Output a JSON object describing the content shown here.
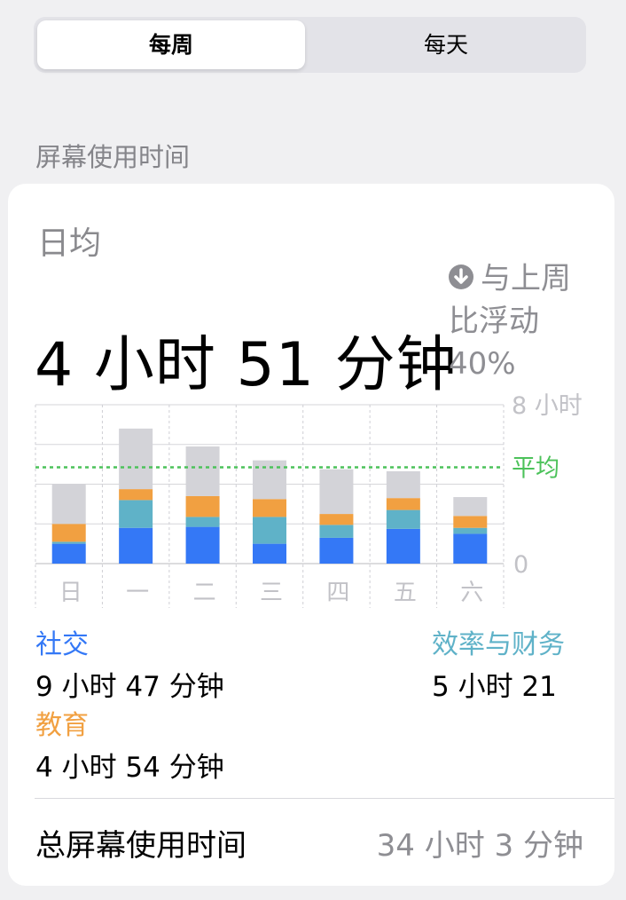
{
  "segment": {
    "weekly": "每周",
    "daily": "每天",
    "selected": "weekly"
  },
  "section_title": "屏幕使用时间",
  "summary": {
    "daily_avg_label": "日均",
    "daily_avg_value": "4 小时 51 分钟",
    "change_text": "与上周比浮动",
    "change_pct": "40%",
    "change_direction": "down"
  },
  "chart_data": {
    "type": "bar",
    "stacked": true,
    "unit": "小时",
    "categories": [
      "日",
      "一",
      "二",
      "三",
      "四",
      "五",
      "六"
    ],
    "series": [
      {
        "name": "社交",
        "color": "#3478f6",
        "values": [
          1.0,
          1.8,
          1.85,
          1.0,
          1.3,
          1.75,
          1.5
        ]
      },
      {
        "name": "效率与财务",
        "color": "#5fb2c8",
        "values": [
          0.1,
          1.4,
          0.5,
          1.35,
          0.65,
          0.95,
          0.3
        ]
      },
      {
        "name": "教育",
        "color": "#f1a041",
        "values": [
          0.9,
          0.55,
          1.05,
          0.9,
          0.55,
          0.6,
          0.6
        ]
      },
      {
        "name": "",
        "color": "#d3d3d8",
        "values": [
          2.0,
          3.05,
          2.5,
          1.95,
          2.25,
          1.35,
          0.95
        ]
      }
    ],
    "ylim": [
      0,
      8
    ],
    "y_tick_labels": [
      "8 小时",
      "0"
    ],
    "average_label": "平均",
    "average_value": 4.85,
    "average_color": "#4cc25a",
    "grid": true
  },
  "legend": [
    {
      "name": "社交",
      "value": "9 小时 47 分钟",
      "color": "#3478f6"
    },
    {
      "name": "效率与财务",
      "value": "5 小时 21",
      "color": "#5fb2c8"
    },
    {
      "name": "教育",
      "value": "4 小时 54 分钟",
      "color": "#f1a041"
    }
  ],
  "total": {
    "label": "总屏幕使用时间",
    "value": "34 小时 3 分钟"
  }
}
